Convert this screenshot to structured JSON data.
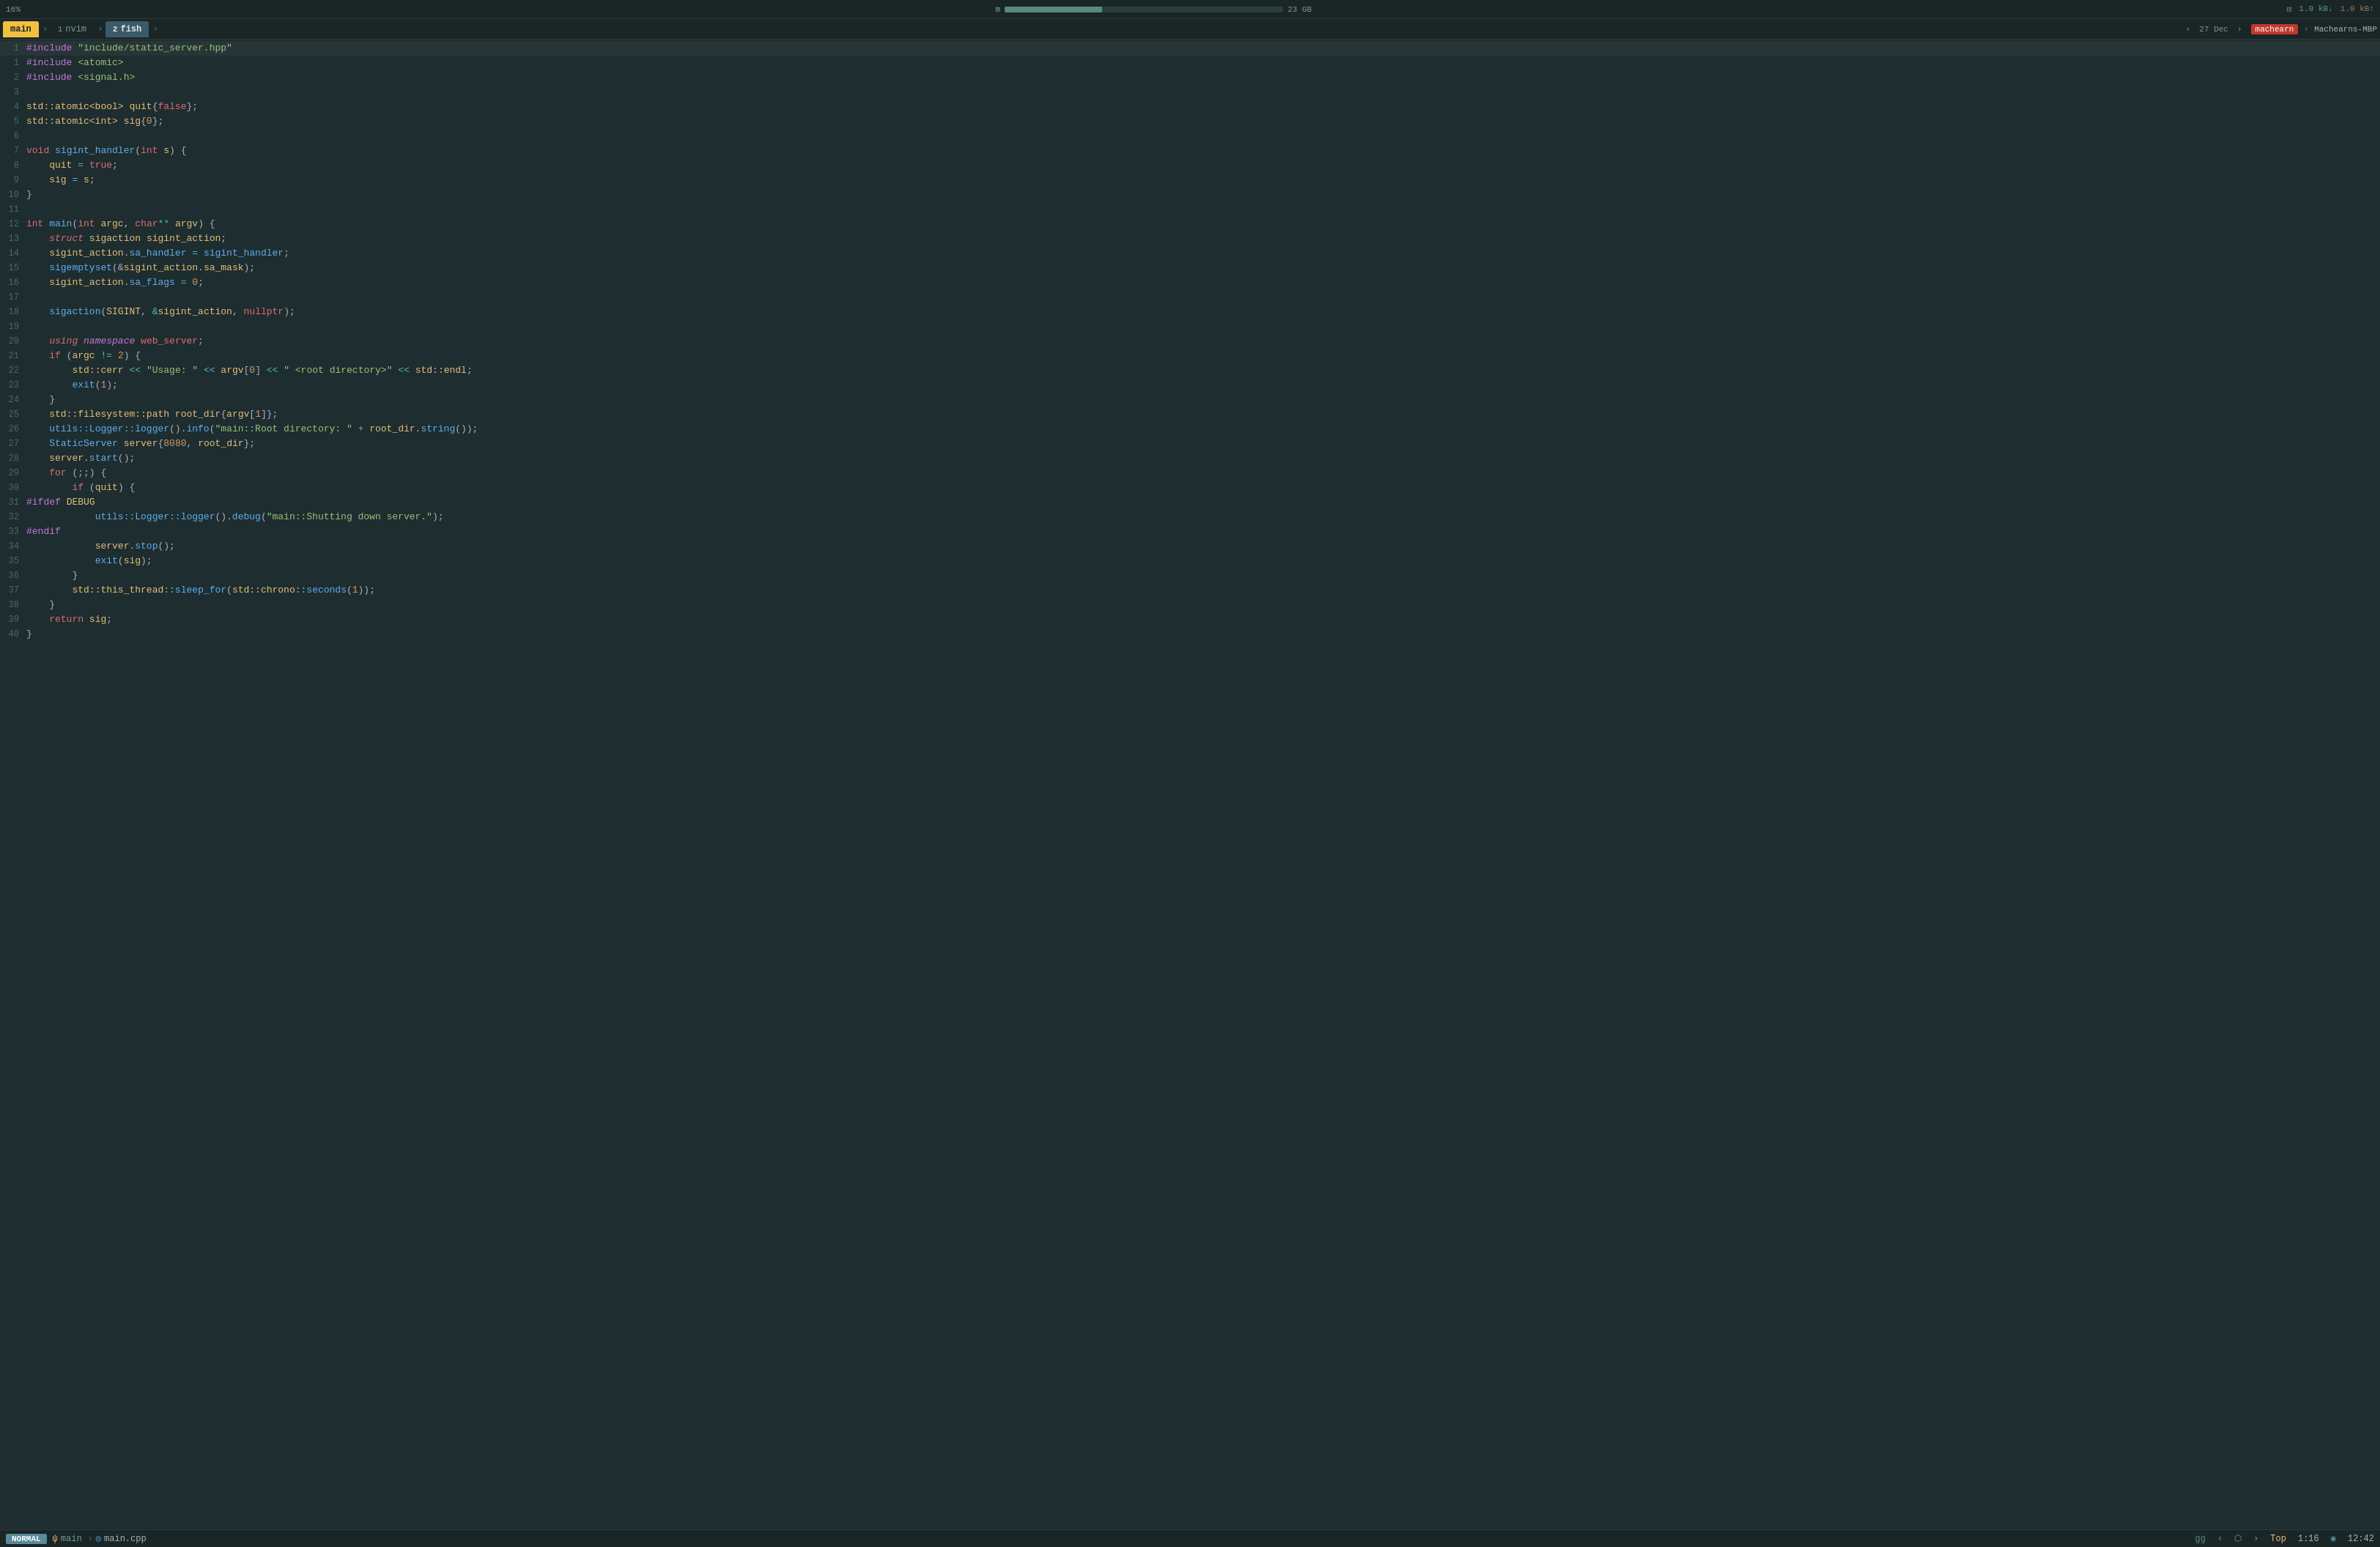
{
  "topbar": {
    "percent": "16%",
    "mem_label": "23 GB",
    "net_label1": "1.0 kB↓",
    "net_label2": "1.0 kB↑",
    "arrows": "↓↑↓↑↓↑"
  },
  "tabs": {
    "main_label": "main",
    "nvim_num": "1",
    "nvim_label": "nvim",
    "fish_num": "2",
    "fish_label": "fish",
    "date": "27 Dec",
    "user": "machearn",
    "host": "Machearns-MBP"
  },
  "statusbar": {
    "mode": "NORMAL",
    "branch_icon": "ψ",
    "branch": "main",
    "file_icon": "◎",
    "file": "main.cpp",
    "gg": "gg",
    "arrow_left": "‹",
    "arrow_right": "›",
    "top": "Top",
    "position": "1:16",
    "clock_icon": "◉",
    "time": "12:42"
  },
  "code": {
    "lines": [
      {
        "num": "1",
        "content": "#include \"include/static_server.hpp\""
      },
      {
        "num": "1",
        "content": "#include <atomic>"
      },
      {
        "num": "2",
        "content": "#include <signal.h>"
      },
      {
        "num": "3",
        "content": ""
      },
      {
        "num": "4",
        "content": "std::atomic<bool> quit{false};"
      },
      {
        "num": "5",
        "content": "std::atomic<int> sig{0};"
      },
      {
        "num": "6",
        "content": ""
      },
      {
        "num": "7",
        "content": "void sigint_handler(int s) {"
      },
      {
        "num": "8",
        "content": "    quit = true;"
      },
      {
        "num": "9",
        "content": "    sig = s;"
      },
      {
        "num": "10",
        "content": "}"
      },
      {
        "num": "11",
        "content": ""
      },
      {
        "num": "12",
        "content": "int main(int argc, char** argv) {"
      },
      {
        "num": "13",
        "content": "    struct sigaction sigint_action;"
      },
      {
        "num": "14",
        "content": "    sigint_action.sa_handler = sigint_handler;"
      },
      {
        "num": "15",
        "content": "    sigemptyset(&sigint_action.sa_mask);"
      },
      {
        "num": "16",
        "content": "    sigint_action.sa_flags = 0;"
      },
      {
        "num": "17",
        "content": ""
      },
      {
        "num": "18",
        "content": "    sigaction(SIGINT, &sigint_action, nullptr);"
      },
      {
        "num": "19",
        "content": ""
      },
      {
        "num": "20",
        "content": "    using namespace web_server;"
      },
      {
        "num": "21",
        "content": "    if (argc != 2) {"
      },
      {
        "num": "22",
        "content": "        std::cerr << \"Usage: \" << argv[0] << \" <root directory>\" << std::endl;"
      },
      {
        "num": "23",
        "content": "        exit(1);"
      },
      {
        "num": "24",
        "content": "    }"
      },
      {
        "num": "25",
        "content": "    std::filesystem::path root_dir{argv[1]};"
      },
      {
        "num": "26",
        "content": "    utils::Logger::logger().info(\"main::Root directory: \" + root_dir.string());"
      },
      {
        "num": "27",
        "content": "    StaticServer server{8080, root_dir};"
      },
      {
        "num": "28",
        "content": "    server.start();"
      },
      {
        "num": "29",
        "content": "    for (;;) {"
      },
      {
        "num": "30",
        "content": "        if (quit) {"
      },
      {
        "num": "31",
        "content": "#ifdef DEBUG"
      },
      {
        "num": "32",
        "content": "            utils::Logger::logger().debug(\"main::Shutting down server.\");"
      },
      {
        "num": "33",
        "content": "#endif"
      },
      {
        "num": "34",
        "content": "            server.stop();"
      },
      {
        "num": "35",
        "content": "            exit(sig);"
      },
      {
        "num": "36",
        "content": "        }"
      },
      {
        "num": "37",
        "content": "        std::this_thread::sleep_for(std::chrono::seconds(1));"
      },
      {
        "num": "38",
        "content": "    }"
      },
      {
        "num": "39",
        "content": "    return sig;"
      },
      {
        "num": "40",
        "content": "}"
      }
    ]
  }
}
